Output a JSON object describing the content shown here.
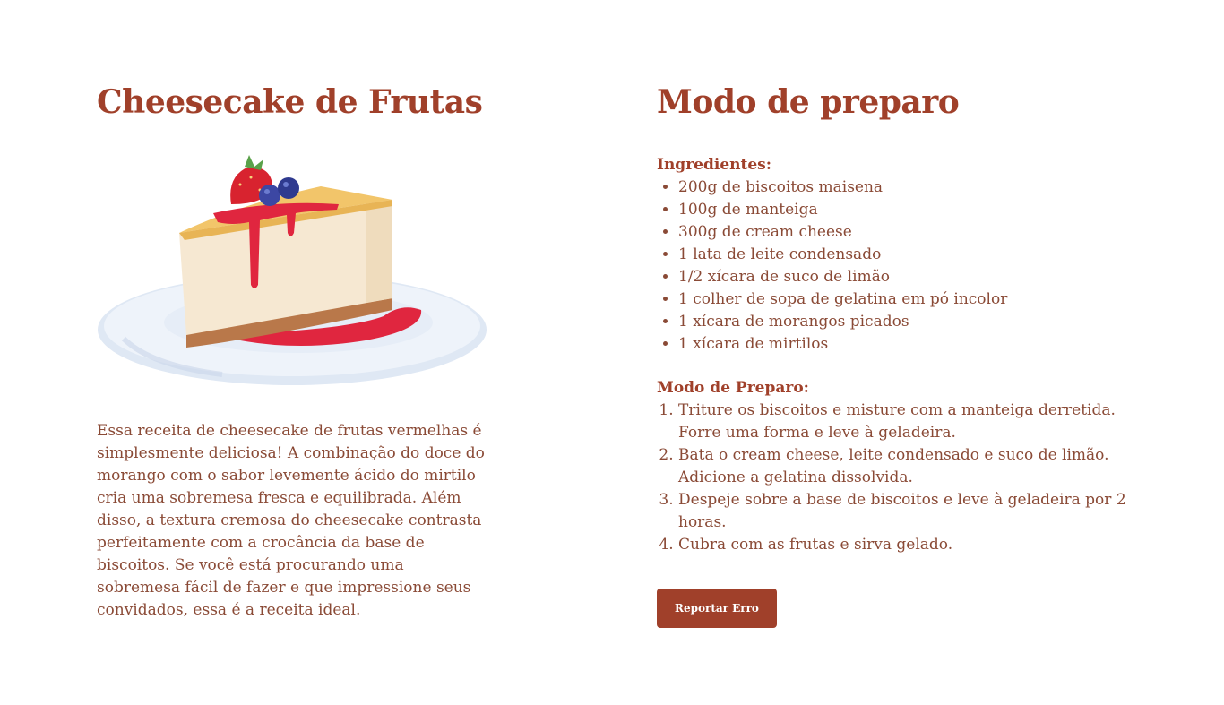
{
  "recipe": {
    "title": "Cheesecake de Frutas",
    "image_icon": "cheesecake-slice-illustration",
    "description": "Essa receita de cheesecake de frutas vermelhas é simplesmente deliciosa! A combinação do doce do morango com o sabor levemente ácido do mirtilo cria uma sobremesa fresca e equilibrada. Além disso, a textura cremosa do cheesecake contrasta perfeitamente com a crocância da base de biscoitos. Se você está procurando uma sobremesa fácil de fazer e que impressione seus convidados, essa é a receita ideal."
  },
  "preparation": {
    "title": "Modo de preparo",
    "ingredients_label": "Ingredientes:",
    "ingredients": [
      "200g de biscoitos maisena",
      "100g de manteiga",
      "300g de cream cheese",
      "1 lata de leite condensado",
      "1/2 xícara de suco de limão",
      "1 colher de sopa de gelatina em pó incolor",
      "1 xícara de morangos picados",
      "1 xícara de mirtilos"
    ],
    "steps_label": "Modo de Preparo:",
    "steps": [
      "Triture os biscoitos e misture com a manteiga derretida. Forre uma forma e leve à geladeira.",
      "Bata o cream cheese, leite condensado e suco de limão. Adicione a gelatina dissolvida.",
      "Despeje sobre a base de biscoitos e leve à geladeira por 2 horas.",
      "Cubra com as frutas e sirva gelado."
    ],
    "report_button": "Reportar Erro"
  },
  "colors": {
    "accent": "#a0402a",
    "text": "#8a4a36",
    "button_text": "#ffffff"
  }
}
